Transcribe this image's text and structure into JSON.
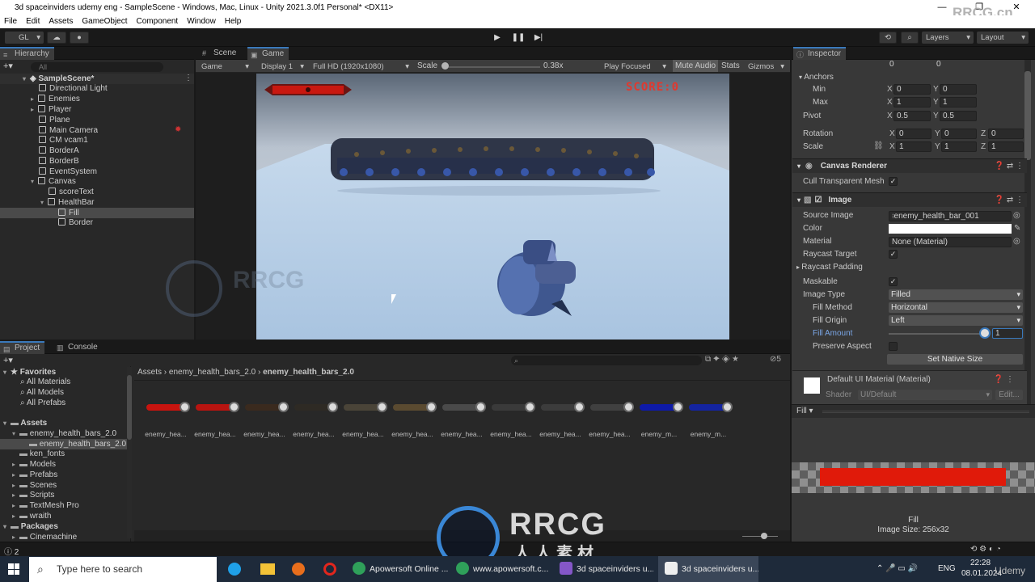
{
  "window": {
    "title": "3d spaceinviders udemy eng - SampleScene - Windows, Mac, Linux - Unity 2021.3.0f1 Personal* <DX11>",
    "controls": [
      "—",
      "❐",
      "✕"
    ]
  },
  "watermark": {
    "top_right": "RRCG.cn",
    "center_main": "RRCG",
    "center_sub": "人人素材"
  },
  "menu": [
    "File",
    "Edit",
    "Assets",
    "GameObject",
    "Component",
    "Window",
    "Help"
  ],
  "toolbar": {
    "account": "GL",
    "layers": "Layers",
    "layout": "Layout"
  },
  "hierarchy": {
    "tab": "Hierarchy",
    "search_placeholder": "All",
    "scene": "SampleScene*",
    "items": [
      {
        "label": "Directional Light"
      },
      {
        "label": "Enemies"
      },
      {
        "label": "Player"
      },
      {
        "label": "Plane"
      },
      {
        "label": "Main Camera"
      },
      {
        "label": "CM vcam1"
      },
      {
        "label": "BorderA"
      },
      {
        "label": "BorderB"
      },
      {
        "label": "EventSystem"
      },
      {
        "label": "Canvas"
      },
      {
        "label": "scoreText"
      },
      {
        "label": "HealthBar"
      },
      {
        "label": "Fill"
      },
      {
        "label": "Border"
      }
    ]
  },
  "game_view": {
    "tabs": [
      "Scene",
      "Game"
    ],
    "mode": "Game",
    "display": "Display 1",
    "resolution": "Full HD (1920x1080)",
    "scale_label": "Scale",
    "scale_value": "0.38x",
    "play_focused": "Play Focused",
    "mute": "Mute Audio",
    "stats": "Stats",
    "gizmos": "Gizmos",
    "score": "SCORE:0"
  },
  "inspector": {
    "tab": "Inspector",
    "rect": {
      "top_values": [
        "0",
        "0"
      ],
      "anchors_label": "Anchors",
      "min_label": "Min",
      "min_x": "0",
      "min_y": "0",
      "max_label": "Max",
      "max_x": "1",
      "max_y": "1",
      "pivot_label": "Pivot",
      "pivot_x": "0.5",
      "pivot_y": "0.5",
      "rotation_label": "Rotation",
      "rot_x": "0",
      "rot_y": "0",
      "rot_z": "0",
      "scale_label": "Scale",
      "scale_x": "1",
      "scale_y": "1",
      "scale_z": "1"
    },
    "canvas_renderer": {
      "title": "Canvas Renderer",
      "cull_label": "Cull Transparent Mesh"
    },
    "image": {
      "title": "Image",
      "source_label": "Source Image",
      "source_value": "enemy_health_bar_001",
      "color_label": "Color",
      "material_label": "Material",
      "material_value": "None (Material)",
      "raycast_target_label": "Raycast Target",
      "raycast_padding_label": "Raycast Padding",
      "maskable_label": "Maskable",
      "image_type_label": "Image Type",
      "image_type_value": "Filled",
      "fill_method_label": "Fill Method",
      "fill_method_value": "Horizontal",
      "fill_origin_label": "Fill Origin",
      "fill_origin_value": "Left",
      "fill_amount_label": "Fill Amount",
      "fill_amount_value": "1",
      "preserve_label": "Preserve Aspect",
      "native_size_button": "Set Native Size"
    },
    "material": {
      "title": "Default UI Material (Material)",
      "shader_label": "Shader",
      "shader_value": "UI/Default",
      "edit_button": "Edit..."
    },
    "preview": {
      "dropdown": "Fill",
      "name": "Fill",
      "size": "Image Size: 256x32"
    }
  },
  "project": {
    "tabs": [
      "Project",
      "Console"
    ],
    "badge": "5",
    "favorites_label": "Favorites",
    "favorites": [
      "All Materials",
      "All Models",
      "All Prefabs"
    ],
    "assets_label": "Assets",
    "assets_tree": [
      "enemy_health_bars_2.0",
      "enemy_health_bars_2.0",
      "ken_fonts",
      "Models",
      "Prefabs",
      "Scenes",
      "Scripts",
      "TextMesh Pro",
      "wraith"
    ],
    "packages_label": "Packages",
    "packages": [
      "Cinemachine"
    ],
    "breadcrumb": [
      "Assets",
      "enemy_health_bars_2.0",
      "enemy_health_bars_2.0"
    ],
    "asset_labels": [
      "enemy_hea...",
      "enemy_hea...",
      "enemy_hea...",
      "enemy_hea...",
      "enemy_hea...",
      "enemy_hea...",
      "enemy_hea...",
      "enemy_hea...",
      "enemy_hea...",
      "enemy_hea...",
      "enemy_m...",
      "enemy_m..."
    ],
    "asset_colors": [
      "#c8140f",
      "#b81410",
      "#3a2a1e",
      "#2e2a24",
      "#4a4438",
      "#5a4a30",
      "#4a4a4a",
      "#3a3a3a",
      "#3c3c3c",
      "#404040",
      "#0e1aa8",
      "#1424a0"
    ]
  },
  "statusbar": {
    "count": "2"
  },
  "taskbar": {
    "search_placeholder": "Type here to search",
    "apps": [
      "Apowersoft Online ...",
      "www.apowersoft.c...",
      "3d spaceinviders u...",
      "3d spaceinviders u..."
    ],
    "lang": "ENG",
    "time": "22:28",
    "date": "08.01.2024",
    "udemy": "Udemy"
  }
}
